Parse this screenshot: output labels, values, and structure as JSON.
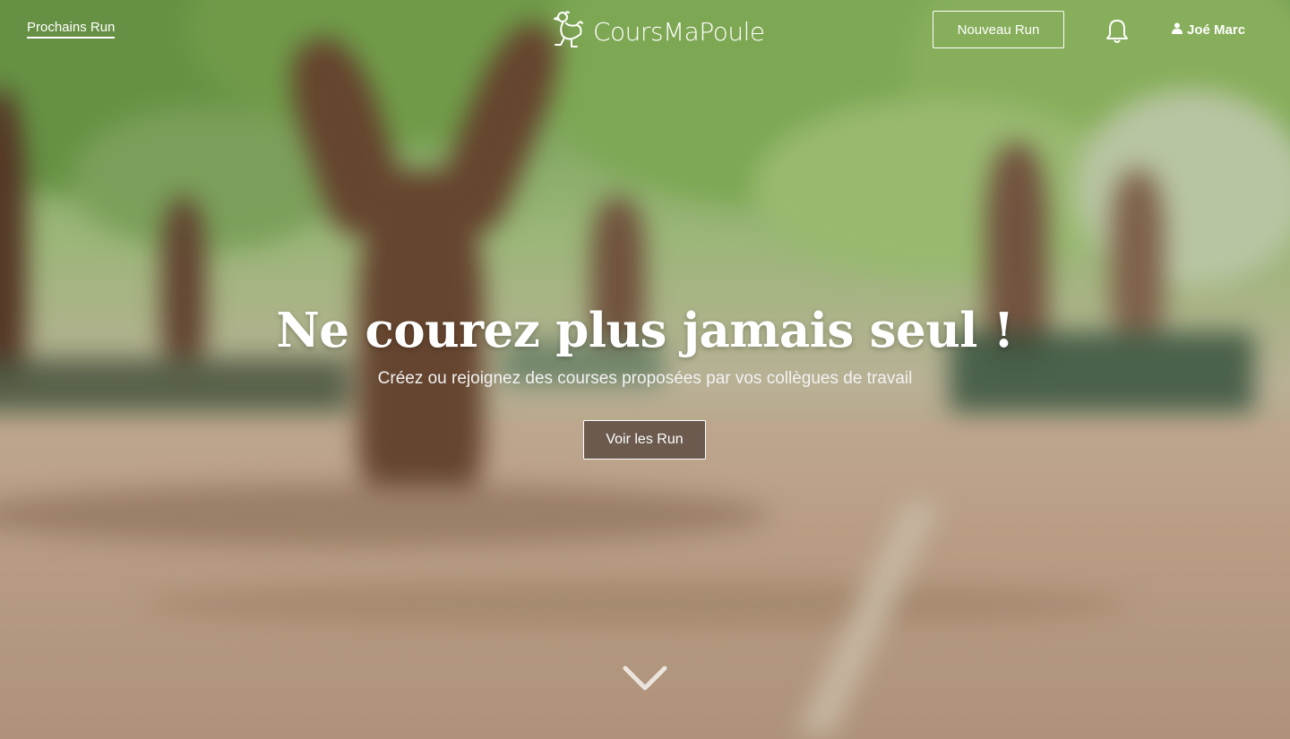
{
  "header": {
    "nav_link": "Prochains Run",
    "logo_text": "CoursMaPoule",
    "new_run_button": "Nouveau Run",
    "user_name": "Joé Marc"
  },
  "hero": {
    "headline": "Ne courez plus jamais seul !",
    "subtitle": "Créez ou rejoignez des courses proposées par vos collègues de travail",
    "cta_button": "Voir les Run"
  },
  "icons": {
    "logo": "chicken-icon",
    "notifications": "bell-icon",
    "user": "user-icon",
    "scroll": "chevron-down-icon"
  },
  "colors": {
    "text": "#ffffff",
    "cta_background": "#3a2c25"
  }
}
